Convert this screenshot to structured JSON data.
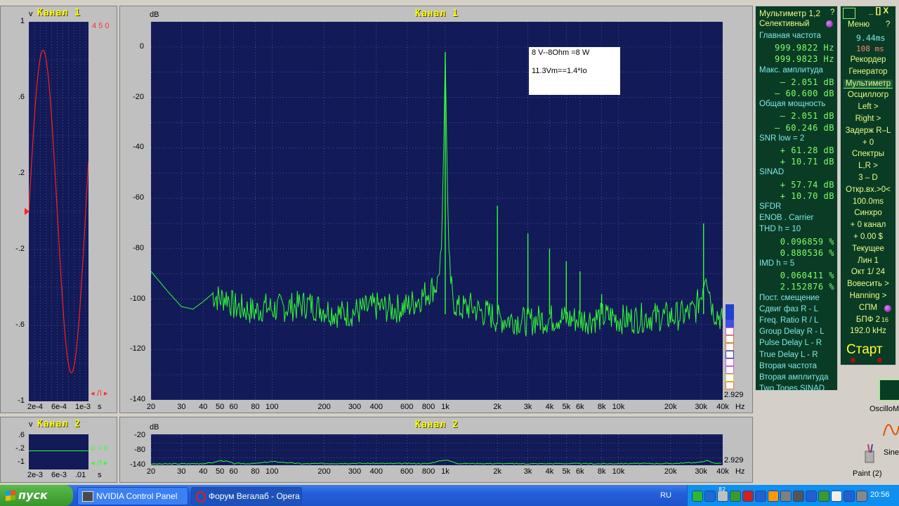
{
  "colors": {
    "plot_bg": "#121a57",
    "trace_main": "#33ff33",
    "trace_sine": "#ff2020",
    "title": "#ffff00"
  },
  "left_panel": {
    "y_unit": "v",
    "title": "Канал 1",
    "indicator": "4 5 0",
    "y_ticks": [
      "1",
      ".6",
      ".2",
      "-.2",
      "-.6",
      "-1"
    ],
    "x_ticks": [
      "2e-4",
      "6e-4",
      "1e-3",
      "s"
    ],
    "trigger_label": "◂ Л ▸"
  },
  "left_bottom": {
    "y_unit": "v",
    "title": "Канал 2",
    "y_ticks": [
      ".6",
      "-.2",
      "-1"
    ],
    "x_ticks": [
      "2e-3",
      "6e-3",
      ".01",
      "s"
    ],
    "indicator": "0 = 0",
    "trigger_label": "◂ Л ▸"
  },
  "main_chart": {
    "title": "Канал 1",
    "y_unit": "dB",
    "x_unit": "Hz",
    "y_ticks": [
      "0",
      "-20",
      "-40",
      "-60",
      "-80",
      "-100",
      "-120",
      "-140"
    ],
    "x_ticks": [
      "20",
      "30",
      "40",
      "50",
      "60",
      "80",
      "100",
      "200",
      "300",
      "400",
      "600",
      "800",
      "1k",
      "2k",
      "3k",
      "4k",
      "5k",
      "6k",
      "8k",
      "10k",
      "20k",
      "30k",
      "40k"
    ],
    "corner_value": "2.929",
    "annotation_line1": "8 V--8Ohm =8 W",
    "annotation_line2": "11.3Vm==1.4*Io"
  },
  "bottom_chart": {
    "title": "Канал 2",
    "y_unit": "dB",
    "x_unit": "Hz",
    "y_ticks": [
      "-20",
      "-80",
      "-140"
    ],
    "x_ticks": [
      "20",
      "30",
      "40",
      "50",
      "60",
      "80",
      "100",
      "200",
      "300",
      "400",
      "600",
      "800",
      "1k",
      "2k",
      "3k",
      "4k",
      "5k",
      "6k",
      "8k",
      "10k",
      "20k",
      "30k",
      "40k"
    ],
    "corner_value": "2.929"
  },
  "chart_data": [
    {
      "type": "line",
      "title": "Канал 1",
      "xlabel": "Hz",
      "ylabel": "dB",
      "xscale": "log",
      "xlim": [
        20,
        40000
      ],
      "ylim": [
        -140,
        10
      ],
      "grid": true,
      "series": [
        {
          "x": [
            20,
            25,
            30,
            35,
            40,
            45,
            50,
            55,
            60,
            70,
            80,
            90,
            100,
            130,
            160,
            200,
            250,
            300,
            350,
            400,
            500,
            600,
            700,
            800,
            900,
            950,
            980,
            1000,
            1020,
            1050,
            1100,
            1200,
            1400,
            1600,
            1800,
            2000,
            2500,
            3000,
            3500,
            4000,
            4500,
            5000,
            5500,
            6000,
            7000,
            8000,
            9000,
            10000,
            12000,
            15000,
            20000,
            25000,
            28000,
            30000,
            32000,
            35000,
            40000
          ],
          "values": [
            -89,
            -97,
            -103,
            -104,
            -101,
            -98,
            -100,
            -99,
            -103,
            -104,
            -105,
            -103,
            -104,
            -103,
            -102,
            -104,
            -106,
            -105,
            -104,
            -103,
            -104,
            -103,
            -100,
            -97,
            -94,
            -80,
            -40,
            -2,
            -40,
            -85,
            -100,
            -104,
            -103,
            -105,
            -106,
            -108,
            -108,
            -109,
            -108,
            -108,
            -107,
            -108,
            -108,
            -108,
            -108,
            -107,
            -107,
            -108,
            -108,
            -107,
            -107,
            -106,
            -104,
            -98,
            -88,
            -104,
            -108
          ]
        }
      ],
      "peaks": [
        {
          "x": 1000,
          "y": -2
        },
        {
          "x": 2000,
          "y": -63
        },
        {
          "x": 3000,
          "y": -74
        },
        {
          "x": 4000,
          "y": -80
        },
        {
          "x": 5000,
          "y": -85
        },
        {
          "x": 6000,
          "y": -89
        },
        {
          "x": 8000,
          "y": -98
        },
        {
          "x": 31000,
          "y": -70
        }
      ]
    },
    {
      "type": "line",
      "title": "Канал 2",
      "xlabel": "Hz",
      "ylabel": "dB",
      "xscale": "log",
      "xlim": [
        20,
        40000
      ],
      "ylim": [
        -140,
        -15
      ],
      "grid": true,
      "series": [
        {
          "x": [
            20,
            30,
            40,
            45,
            50,
            55,
            60,
            80,
            100,
            150,
            200,
            300,
            500,
            800,
            1000,
            1200,
            2000,
            3000,
            5000,
            8000,
            10000,
            20000,
            30000,
            32000,
            35000,
            40000
          ],
          "values": [
            -135,
            -134,
            -133,
            -130,
            -122,
            -124,
            -133,
            -133,
            -125,
            -134,
            -133,
            -132,
            -133,
            -133,
            -118,
            -133,
            -133,
            -134,
            -133,
            -134,
            -133,
            -133,
            -128,
            -120,
            -130,
            -133
          ]
        }
      ]
    },
    {
      "type": "line",
      "title": "Канал 1",
      "xlabel": "s",
      "ylabel": "v",
      "xlim": [
        0,
        0.00105
      ],
      "ylim": [
        -1,
        1
      ],
      "grid": true,
      "series": [
        {
          "name": "waveform",
          "shape": "sine",
          "amplitude": 0.85,
          "period": 0.001,
          "phase_start": 0
        }
      ]
    }
  ],
  "multimeter": {
    "header": "Мультиметр 1,2",
    "help": "?",
    "mode": "Селективный",
    "rows": [
      {
        "label": "Главная частота"
      },
      {
        "value": "999.9822  Hz"
      },
      {
        "value": "999.9823  Hz"
      },
      {
        "label": "Макс. амплитуда"
      },
      {
        "value": "–   2.051 dB"
      },
      {
        "value": "–  60.600 dB"
      },
      {
        "label": "Общая мощность"
      },
      {
        "value": "–   2.051 dB"
      },
      {
        "value": "–  60.246 dB"
      },
      {
        "label": "SNR    low =    2"
      },
      {
        "value": "+  61.28 dB"
      },
      {
        "value": "+  10.71 dB"
      },
      {
        "label": "SINAD"
      },
      {
        "value": "+  57.74 dB"
      },
      {
        "value": "+  10.70 dB"
      },
      {
        "label": "SFDR"
      },
      {
        "label": "ENOB . Carrier"
      },
      {
        "label": "THD       h =    10"
      },
      {
        "value": "0.096859 %"
      },
      {
        "value": "0.880536 %"
      },
      {
        "label": "IMD       h =     5"
      },
      {
        "value": "0.060411 %"
      },
      {
        "value": "2.152876 %"
      },
      {
        "label": "Пост. смещение"
      },
      {
        "label": "Сдвиг фаз R - L"
      },
      {
        "label": "Freq. Ratio  R / L"
      },
      {
        "label": "Group Delay R - L"
      },
      {
        "label": "Pulse Delay L - R"
      },
      {
        "label": "True  Delay L - R"
      },
      {
        "label": "Вторая частота"
      },
      {
        "label": "Вторая амплитуда"
      },
      {
        "label": "Two Tones SINAD"
      }
    ]
  },
  "controls": {
    "menu": "Меню",
    "help": "?",
    "close": "_ [] X",
    "ms1": "9.44ms",
    "ms2": "108  ms",
    "items": [
      "Рекордер",
      "Генератор",
      "Мультиметр",
      "Осциллогр",
      "Left      >",
      "Right      >",
      "Задерж R–L",
      "+        0",
      "Спектры",
      "L,R       >",
      "3 – D",
      "Откр.вх.>0<",
      "100.0ms",
      "Синхро",
      "+ 0 канал",
      "+  0.00 $",
      "Текущее",
      "Лин         1",
      "Окт   1/ 24",
      "Вовесить  >",
      "Hanning   >",
      "СПМ",
      "БПФ    2",
      "192.0 kHz"
    ],
    "fft_exp": "16",
    "start": "Старт"
  },
  "desktop": {
    "icon1_label": "OscilloMe",
    "icon2_label": "Sine",
    "icon3_label": "Paint (2)"
  },
  "taskbar": {
    "start": "пуск",
    "task1": "NVIDIA Control Panel",
    "task2": "Форум Вегалаб - Opera",
    "lang": "RU",
    "tray_num": "82",
    "clock": "20:56"
  }
}
